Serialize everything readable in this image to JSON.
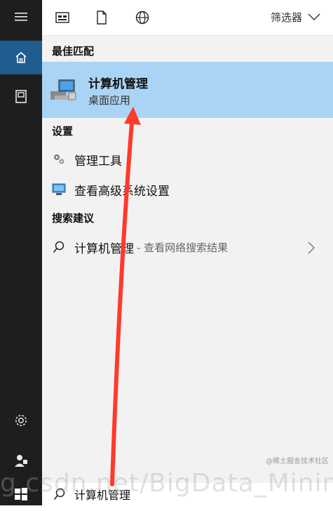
{
  "topbar": {
    "icons": [
      "apps-icon",
      "document-icon",
      "globe-icon"
    ],
    "filter_label": "筛选器"
  },
  "sections": {
    "best_match": "最佳匹配",
    "settings": "设置",
    "suggestions": "搜索建议"
  },
  "best_match": {
    "title": "计算机管理",
    "subtitle": "桌面应用"
  },
  "settings_items": [
    {
      "label": "管理工具",
      "icon": "admin-tools-icon"
    },
    {
      "label": "查看高级系统设置",
      "icon": "monitor-icon"
    }
  ],
  "suggestion": {
    "label": "计算机管理",
    "hint": "- 查看网络搜索结果"
  },
  "search": {
    "value": "计算机管理"
  },
  "sidebar": {
    "items": [
      "menu-icon",
      "home-icon",
      "notebook-icon",
      "settings-icon",
      "user-icon",
      "windows-icon"
    ]
  },
  "watermark": {
    "url_fragment": "g.csdn.net/BigData_Mining",
    "small": "@稀土掘金技术社区"
  },
  "colors": {
    "rail": "#1e1e1e",
    "active_rail": "#1f5c8f",
    "highlight": "#a9d4f5",
    "arrow": "#ff3a2a"
  }
}
